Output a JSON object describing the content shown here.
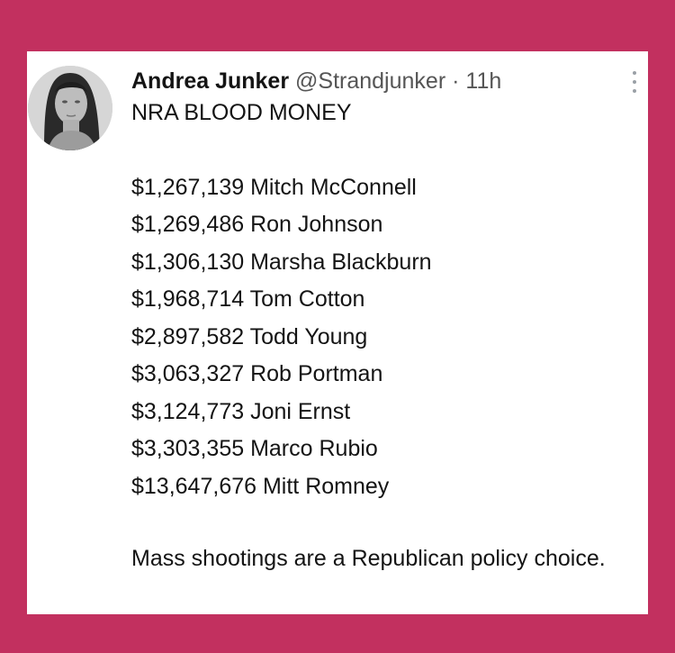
{
  "tweet": {
    "author_name": "Andrea Junker",
    "handle": "@Strandjunker",
    "separator": "·",
    "time_ago": "11h",
    "headline": "NRA BLOOD MONEY",
    "donations": [
      {
        "amount": "$1,267,139",
        "name": "Mitch McConnell"
      },
      {
        "amount": "$1,269,486",
        "name": "Ron Johnson"
      },
      {
        "amount": "$1,306,130",
        "name": "Marsha Blackburn"
      },
      {
        "amount": "$1,968,714",
        "name": "Tom Cotton"
      },
      {
        "amount": "$2,897,582",
        "name": "Todd Young"
      },
      {
        "amount": "$3,063,327",
        "name": "Rob Portman"
      },
      {
        "amount": "$3,124,773",
        "name": "Joni Ernst"
      },
      {
        "amount": "$3,303,355",
        "name": "Marco Rubio"
      },
      {
        "amount": "$13,647,676",
        "name": "Mitt Romney"
      }
    ],
    "closing": "Mass shootings are a Republican policy choice."
  },
  "colors": {
    "background": "#c2305f",
    "card": "#ffffff",
    "text": "#141414",
    "muted": "#555555"
  },
  "icons": {
    "more": "more-options-icon",
    "avatar": "profile-avatar"
  }
}
